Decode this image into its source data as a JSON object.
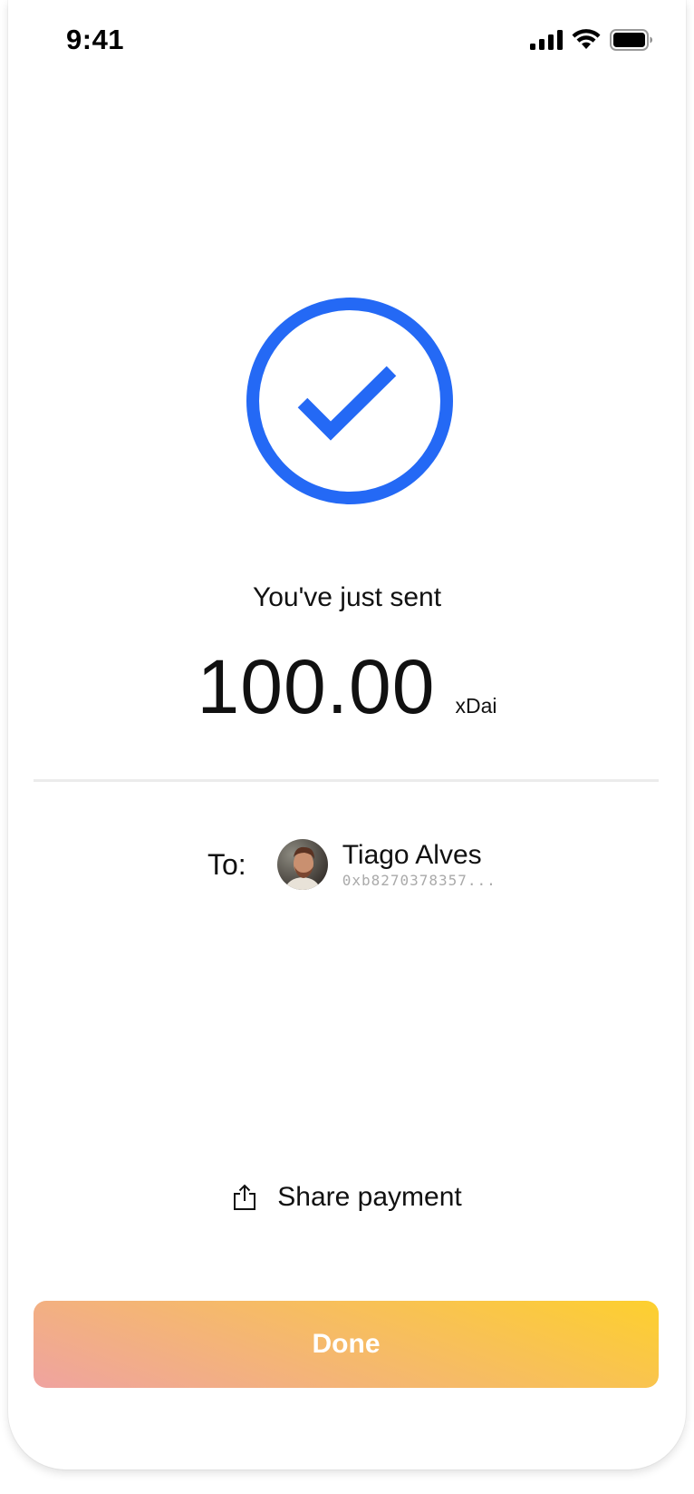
{
  "status_bar": {
    "time": "9:41",
    "icons": [
      "signal-icon",
      "wifi-icon",
      "battery-icon"
    ]
  },
  "success": {
    "icon": "check-circle-icon",
    "color": "#2469f5"
  },
  "headline": "You've just sent",
  "payment": {
    "amount": "100.00",
    "currency": "xDai"
  },
  "recipient": {
    "label": "To:",
    "name": "Tiago Alves",
    "address": "0xb8270378357..."
  },
  "share": {
    "label": "Share payment",
    "icon": "share-icon"
  },
  "done_button": {
    "label": "Done"
  }
}
